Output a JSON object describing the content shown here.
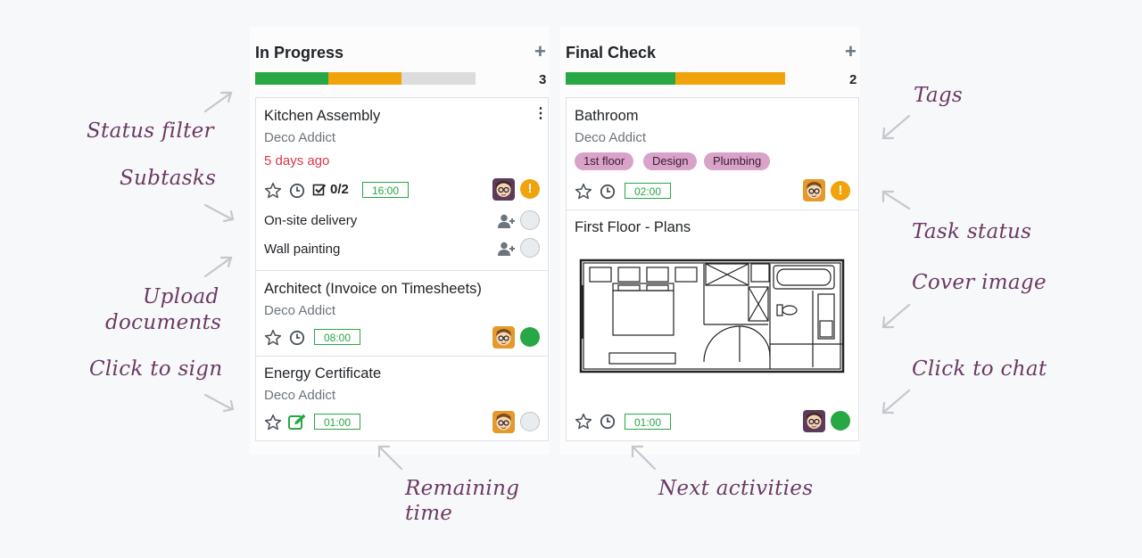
{
  "columns": [
    {
      "title": "In Progress",
      "count": "3",
      "progress": {
        "done": 0.25,
        "warning": 0.25,
        "rest": 0.25
      },
      "cards": [
        {
          "title": "Kitchen Assembly",
          "customer": "Deco Addict",
          "deadline": "5 days ago",
          "subtask_count": "0/2",
          "time": "16:00",
          "status": "warning",
          "subtasks": [
            "On-site delivery",
            "Wall painting"
          ]
        },
        {
          "title": "Architect (Invoice on Timesheets)",
          "customer": "Deco Addict",
          "time": "08:00",
          "status": "done"
        },
        {
          "title": "Energy Certificate",
          "customer": "Deco Addict",
          "time": "01:00",
          "status": "normal"
        }
      ]
    },
    {
      "title": "Final Check",
      "count": "2",
      "progress": {
        "done": 0.5,
        "warning": 0.5,
        "rest": 0
      },
      "cards": [
        {
          "title": "Bathroom",
          "customer": "Deco Addict",
          "tags": [
            "1st floor",
            "Design",
            "Plumbing"
          ],
          "time": "02:00",
          "status": "warning"
        },
        {
          "title": "First Floor - Plans",
          "time": "01:00",
          "status": "done"
        }
      ]
    }
  ],
  "annotations": {
    "status_filter": "Status filter",
    "subtasks": "Subtasks",
    "upload_line1": "Upload",
    "upload_line2": "documents",
    "click_to_sign": "Click to sign",
    "tags": "Tags",
    "task_status": "Task status",
    "cover_image": "Cover image",
    "click_to_chat": "Click to chat",
    "remaining_line1": "Remaining",
    "remaining_line2": "time",
    "next_activities": "Next activities"
  },
  "icons": {
    "star": "star-icon",
    "clock": "clock-icon",
    "checkbox": "checkbox-icon",
    "sign": "sign-icon",
    "add_user": "add-user-icon",
    "kebab": "kebab-menu-icon"
  },
  "colors": {
    "done": "#28a745",
    "warning": "#f0a30a",
    "danger": "#dc3545",
    "tag": "#d8a2c9",
    "annotation": "#6b3a63"
  }
}
